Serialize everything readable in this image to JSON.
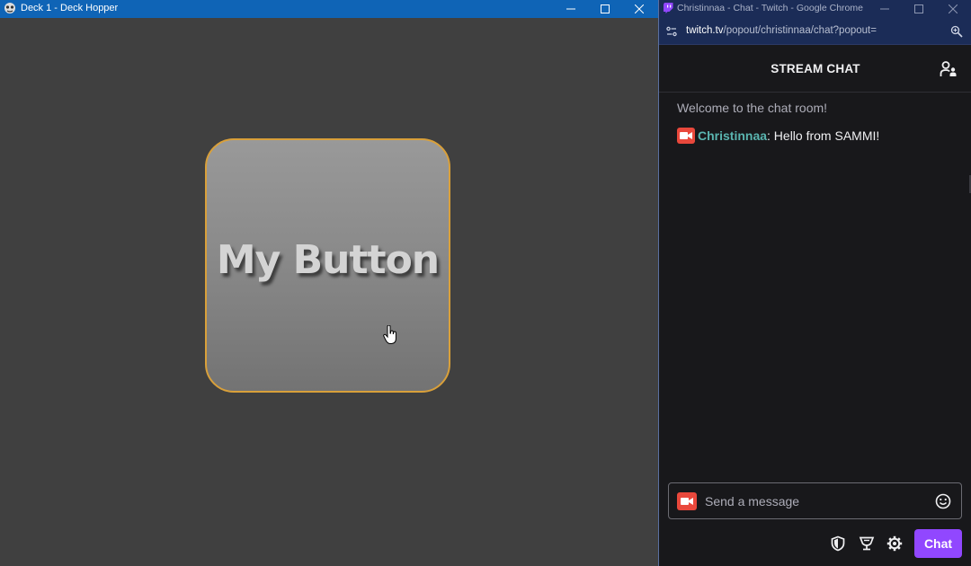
{
  "deck_window": {
    "title": "Deck 1 - Deck Hopper",
    "button_label": "My Button"
  },
  "chrome_window": {
    "title": "Christinnaa - Chat - Twitch - Google Chrome",
    "url_host": "twitch.tv",
    "url_path": "/popout/christinnaa/chat?popout="
  },
  "chat": {
    "header_title": "STREAM CHAT",
    "welcome_message": "Welcome to the chat room!",
    "messages": [
      {
        "user": "Christinnaa",
        "separator": ":",
        "text": " Hello from SAMMI!"
      }
    ],
    "input_placeholder": "Send a message",
    "send_label": "Chat"
  },
  "colors": {
    "titlebar_blue": "#0f64b6",
    "button_border": "#d9a03a",
    "twitch_purple": "#9147ff",
    "username_teal": "#5ab5b0",
    "badge_red": "#e9483c"
  },
  "icons": {
    "deck_app": "deck-hopper-app-icon",
    "favicon": "twitch-favicon",
    "site_info": "site-info-icon",
    "zoom": "zoom-icon",
    "users": "community-icon",
    "badge": "broadcaster-badge-icon",
    "emote": "emote-picker-icon",
    "mod": "shield-icon",
    "drops": "chalice-icon",
    "settings": "gear-icon"
  }
}
